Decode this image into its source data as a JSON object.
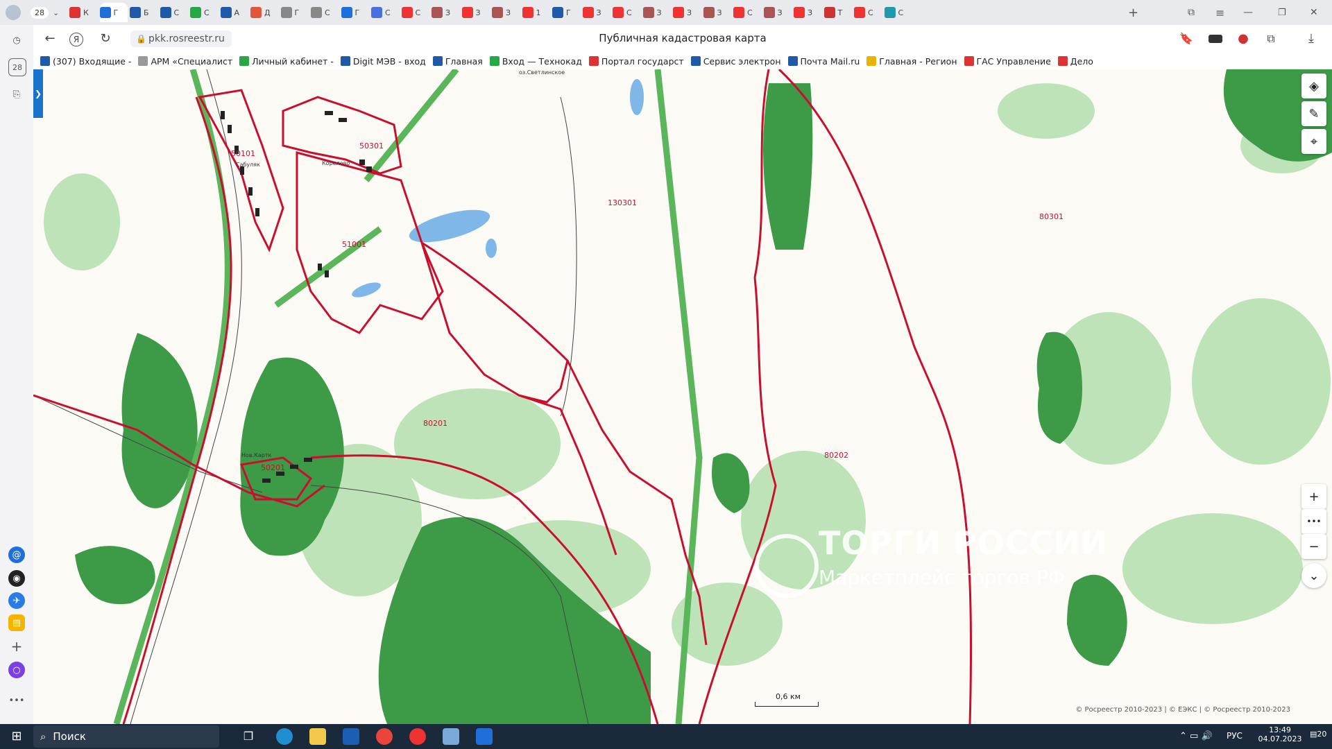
{
  "tabs": [
    {
      "label": "К",
      "color": "#d33"
    },
    {
      "label": "Г",
      "color": "#1e6fd9",
      "active": true
    },
    {
      "label": "Б",
      "color": "#1e5aa8"
    },
    {
      "label": "С",
      "color": "#1e5aa8"
    },
    {
      "label": "С",
      "color": "#28a745"
    },
    {
      "label": "А",
      "color": "#1e5aa8"
    },
    {
      "label": "Д",
      "color": "#e0563b"
    },
    {
      "label": "Г",
      "color": "#888"
    },
    {
      "label": "С",
      "color": "#888"
    },
    {
      "label": "Г",
      "color": "#1e6fd9"
    },
    {
      "label": "С",
      "color": "#4a6fe0"
    },
    {
      "label": "С",
      "color": "#e33"
    },
    {
      "label": "З",
      "color": "#a55"
    },
    {
      "label": "З",
      "color": "#e33"
    },
    {
      "label": "З",
      "color": "#a55"
    },
    {
      "label": "1",
      "color": "#e33"
    },
    {
      "label": "Г",
      "color": "#1e5aa8"
    },
    {
      "label": "З",
      "color": "#e33"
    },
    {
      "label": "С",
      "color": "#e33"
    },
    {
      "label": "З",
      "color": "#a55"
    },
    {
      "label": "З",
      "color": "#e33"
    },
    {
      "label": "З",
      "color": "#a55"
    },
    {
      "label": "С",
      "color": "#e33"
    },
    {
      "label": "З",
      "color": "#a55"
    },
    {
      "label": "З",
      "color": "#e33"
    },
    {
      "label": "Т",
      "color": "#c33"
    },
    {
      "label": "С",
      "color": "#e33"
    },
    {
      "label": "С",
      "color": "#29a"
    }
  ],
  "tab_count_badge": "28",
  "sidebar_badge": "28",
  "address": {
    "url": "pkk.rosreestr.ru",
    "title": "Публичная кадастровая карта"
  },
  "bookmarks": [
    {
      "label": "(307) Входящие -",
      "color": "#1e5aa8"
    },
    {
      "label": "АРМ «Специалист",
      "color": "#999"
    },
    {
      "label": "Личный кабинет -",
      "color": "#28a745"
    },
    {
      "label": "Digit МЭВ - вход",
      "color": "#1e5aa8"
    },
    {
      "label": "Главная",
      "color": "#1e5aa8"
    },
    {
      "label": "Вход — Технокад",
      "color": "#28a745"
    },
    {
      "label": "Портал государст",
      "color": "#d33"
    },
    {
      "label": "Сервис электрон",
      "color": "#1e5aa8"
    },
    {
      "label": "Почта Mail.ru",
      "color": "#1e5aa8"
    },
    {
      "label": "Главная - Регион",
      "color": "#e8b400"
    },
    {
      "label": "ГАС Управление",
      "color": "#d33"
    },
    {
      "label": "Дело",
      "color": "#d33"
    }
  ],
  "map": {
    "labels": [
      {
        "text": "50101",
        "kind": "quarter"
      },
      {
        "text": "50301",
        "kind": "quarter"
      },
      {
        "text": "51001",
        "kind": "quarter"
      },
      {
        "text": "130301",
        "kind": "quarter"
      },
      {
        "text": "80301",
        "kind": "quarter"
      },
      {
        "text": "80201",
        "kind": "quarter"
      },
      {
        "text": "50201",
        "kind": "quarter"
      },
      {
        "text": "80202",
        "kind": "quarter"
      },
      {
        "text": "Сабуляк",
        "kind": "place"
      },
      {
        "text": "Корелево",
        "kind": "place"
      },
      {
        "text": "Нов.Картк",
        "kind": "place"
      },
      {
        "text": "оз.Светлинское",
        "kind": "place"
      }
    ],
    "scale_label": "0,6 км",
    "watermark_title": "ТОРГИ РОССИИ",
    "watermark_sub": "Маркетплейс торгов РФ",
    "copyright": "© Росреестр 2010-2023 | © ЕЭКС | © Росреестр 2010-2023"
  },
  "taskbar": {
    "search_placeholder": "Поиск",
    "lang": "РУС",
    "time": "13:49",
    "date": "04.07.2023",
    "notif_count": "20"
  },
  "colors": {
    "boundary_red": "#c8102e",
    "forest_dark": "#3d9a47",
    "forest_light": "#bfe3b9",
    "water": "#7fb8e8",
    "road_green": "#5bb55a"
  }
}
